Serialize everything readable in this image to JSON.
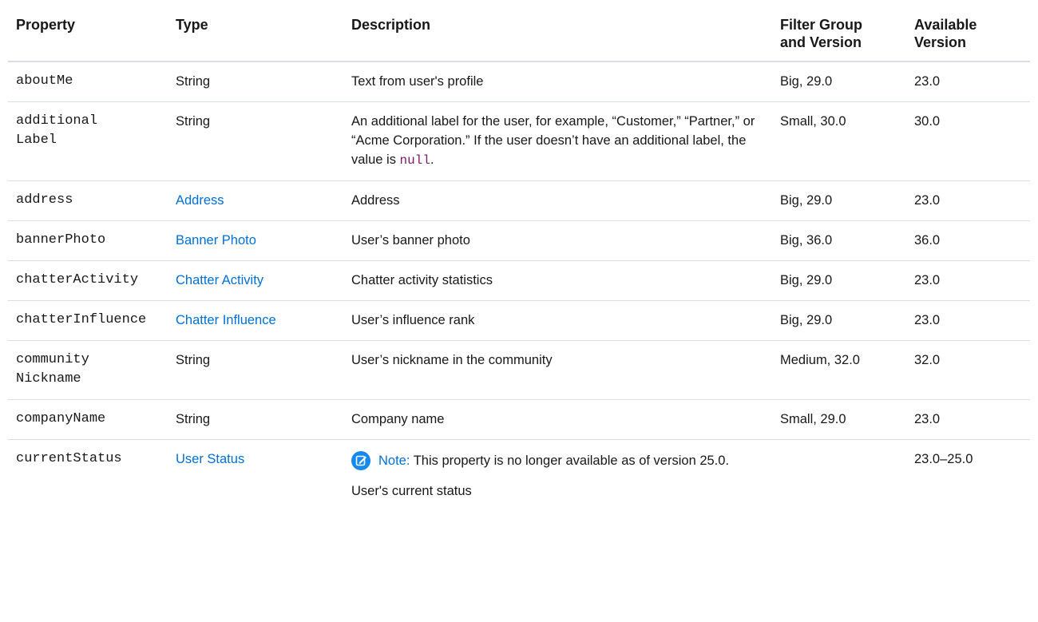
{
  "headers": {
    "property": "Property",
    "type": "Type",
    "description": "Description",
    "filter_group_line1": "Filter Group",
    "filter_group_line2": "and Version",
    "available_line1": "Available",
    "available_line2": "Version"
  },
  "rows": [
    {
      "property_l1": "aboutMe",
      "type": "String",
      "type_is_link": false,
      "description": "Text from user's profile",
      "filter": "Big, 29.0",
      "available": "23.0"
    },
    {
      "property_l1": "additional",
      "property_l2": "Label",
      "type": "String",
      "type_is_link": false,
      "description_before": "An additional label for the user, for example, “Customer,” “Partner,” or “Acme Corporation.” If the user doesn’t have an additional label, the value is ",
      "description_code": "null",
      "description_after": ".",
      "filter": "Small, 30.0",
      "available": "30.0"
    },
    {
      "property_l1": "address",
      "type": "Address",
      "type_is_link": true,
      "description": "Address",
      "filter": "Big, 29.0",
      "available": "23.0"
    },
    {
      "property_l1": "bannerPhoto",
      "type": "Banner Photo",
      "type_is_link": true,
      "description": "User’s banner photo",
      "filter": "Big, 36.0",
      "available": "36.0"
    },
    {
      "property_l1": "chatterActivity",
      "type": "Chatter Activity",
      "type_is_link": true,
      "description": "Chatter activity statistics",
      "filter": "Big, 29.0",
      "available": "23.0"
    },
    {
      "property_l1": "chatterInfluence",
      "type": "Chatter Influence",
      "type_is_link": true,
      "description": "User’s influence rank",
      "filter": "Big, 29.0",
      "available": "23.0"
    },
    {
      "property_l1": "community",
      "property_l2": "Nickname",
      "type": "String",
      "type_is_link": false,
      "description": "User’s nickname in the community",
      "filter": "Medium, 32.0",
      "available": "32.0"
    },
    {
      "property_l1": "companyName",
      "type": "String",
      "type_is_link": false,
      "description": "Company name",
      "filter": "Small, 29.0",
      "available": "23.0"
    },
    {
      "property_l1": "currentStatus",
      "type": "User Status",
      "type_is_link": true,
      "note_label": "Note:",
      "note_text": " This property is no longer available as of version 25.0.",
      "description": "User's current status",
      "filter": "",
      "available": "23.0–25.0"
    }
  ],
  "icons": {
    "note": "note-edit-icon"
  },
  "colors": {
    "link": "#0070d2",
    "code": "#7a1a6b",
    "note_icon": "#1589ee"
  }
}
